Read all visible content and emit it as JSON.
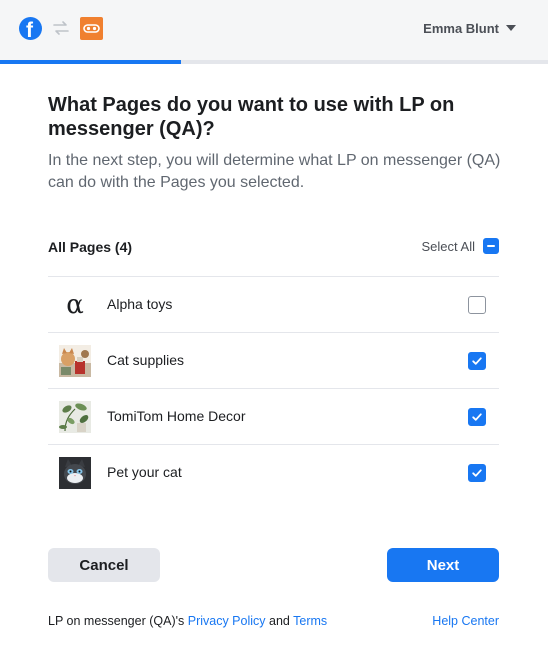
{
  "header": {
    "brand_icon": "facebook-icon",
    "swap_icon": "swap-arrows-icon",
    "app_icon": "app-icon",
    "user_name": "Emma Blunt"
  },
  "progress": {
    "fraction": 0.33,
    "color": "#1877f2"
  },
  "dialog": {
    "title": "What Pages do you want to use with LP on messenger (QA)?",
    "subtitle": "In the next step, you will determine what LP on messenger (QA) can do with the Pages you selected."
  },
  "list": {
    "header_label": "All Pages (4)",
    "select_all_label": "Select All",
    "select_all_state": "indeterminate",
    "pages": [
      {
        "name": "Alpha toys",
        "avatar": "alpha-symbol-icon",
        "avatar_glyph": "α",
        "checked": false
      },
      {
        "name": "Cat supplies",
        "avatar": "cat-supplies-photo",
        "checked": true
      },
      {
        "name": "TomiTom Home Decor",
        "avatar": "home-decor-photo",
        "checked": true
      },
      {
        "name": "Pet your cat",
        "avatar": "cat-photo",
        "checked": true
      }
    ]
  },
  "actions": {
    "cancel_label": "Cancel",
    "next_label": "Next"
  },
  "footer": {
    "app_name": "LP on messenger (QA)'s",
    "privacy_label": "Privacy Policy",
    "and_text": "and",
    "terms_label": "Terms",
    "help_label": "Help Center"
  },
  "colors": {
    "accent": "#1877f2",
    "app_icon": "#f0802f",
    "topbar": "#f5f6f7"
  }
}
